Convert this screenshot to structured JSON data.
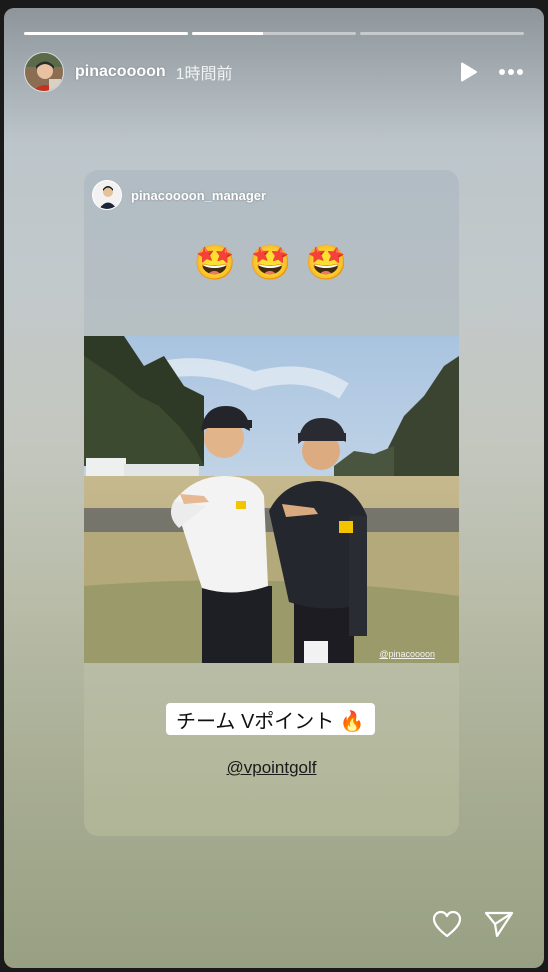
{
  "story": {
    "username": "pinacoooon",
    "time_ago": "1時間前",
    "progress": [
      1,
      0.43,
      0
    ]
  },
  "repost": {
    "username": "pinacoooon_manager",
    "emojis": [
      "🤩",
      "🤩",
      "🤩"
    ],
    "photo_watermark": "@pinacoooon",
    "caption_sticker": "チーム Vポイント 🔥",
    "mention": "@vpointgolf"
  },
  "icons": {
    "play": "play-icon",
    "more": "more-options-icon",
    "like": "heart-icon",
    "share": "send-icon"
  },
  "colors": {
    "accent_white": "#ffffff",
    "background": "#1a1a1a"
  }
}
